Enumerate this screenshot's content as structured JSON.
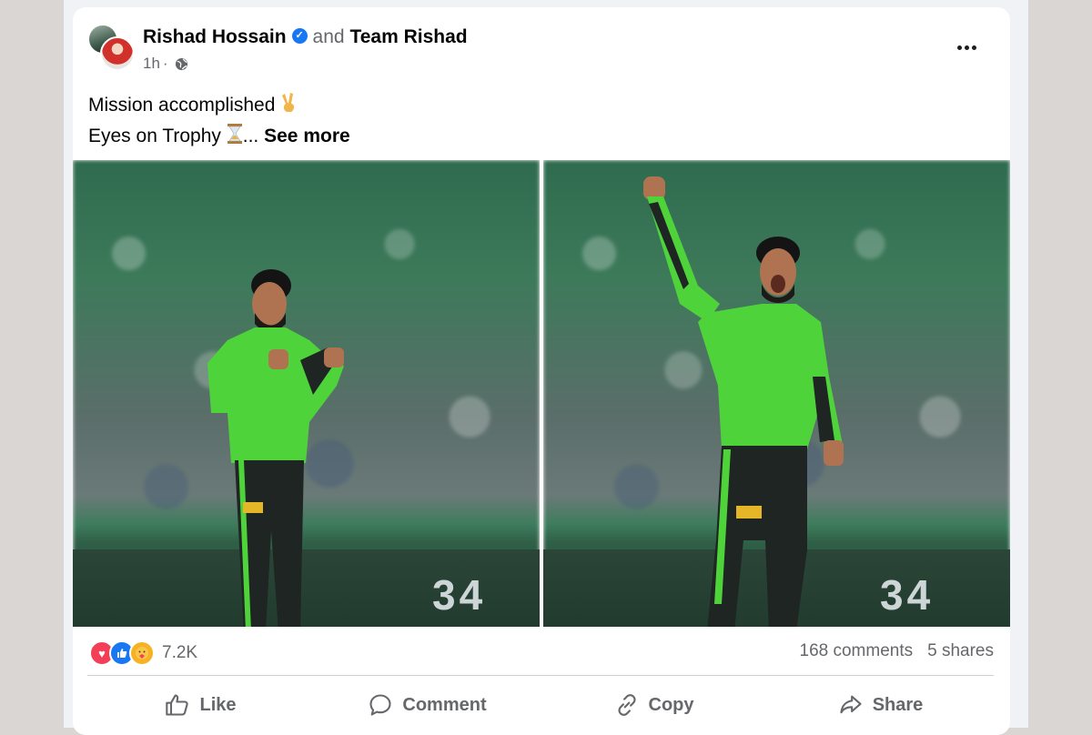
{
  "post": {
    "author": "Rishad Hossain",
    "conjunction": "and",
    "coauthor": "Team Rishad",
    "time": "1h",
    "separator": "·",
    "text_line1": "Mission accomplished",
    "text_line2": "Eyes on Trophy",
    "ellipsis": "...",
    "see_more": "See more",
    "emoji1": "✌️",
    "emoji2": "⏳"
  },
  "photos": {
    "left_board": "34",
    "right_board": "34"
  },
  "engagement": {
    "reaction_count": "7.2K",
    "comments": "168 comments",
    "shares": "5 shares",
    "reaction_icons": [
      "love",
      "like",
      "care"
    ]
  },
  "actions": {
    "like": "Like",
    "comment": "Comment",
    "copy": "Copy",
    "share": "Share"
  },
  "colors": {
    "accent": "#1877f2",
    "jersey": "#4fd33b",
    "love": "#f33e58",
    "care": "#f7b125"
  }
}
